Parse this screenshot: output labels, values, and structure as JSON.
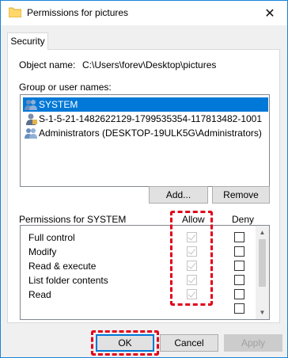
{
  "window": {
    "title": "Permissions for pictures",
    "close_glyph": "✕"
  },
  "tab": {
    "label": "Security"
  },
  "object": {
    "label": "Object name:",
    "value": "C:\\Users\\forev\\Desktop\\pictures"
  },
  "groups": {
    "label": "Group or user names:",
    "items": [
      {
        "name": "SYSTEM",
        "icon": "users-group-icon",
        "selected": true
      },
      {
        "name": "S-1-5-21-1482622129-1799535354-117813482-1001",
        "icon": "user-unknown-icon",
        "selected": false
      },
      {
        "name": "Administrators (DESKTOP-19ULK5G\\Administrators)",
        "icon": "users-group-icon",
        "selected": false
      }
    ]
  },
  "buttons": {
    "add": "Add...",
    "remove": "Remove",
    "ok": "OK",
    "cancel": "Cancel",
    "apply": "Apply"
  },
  "permissions": {
    "label": "Permissions for SYSTEM",
    "allow_header": "Allow",
    "deny_header": "Deny",
    "rows": [
      {
        "name": "Full control",
        "allow": true,
        "deny": false
      },
      {
        "name": "Modify",
        "allow": true,
        "deny": false
      },
      {
        "name": "Read & execute",
        "allow": true,
        "deny": false
      },
      {
        "name": "List folder contents",
        "allow": true,
        "deny": false
      },
      {
        "name": "Read",
        "allow": true,
        "deny": false
      }
    ]
  },
  "colors": {
    "highlight": "#e2001a",
    "selection": "#0078d7"
  }
}
